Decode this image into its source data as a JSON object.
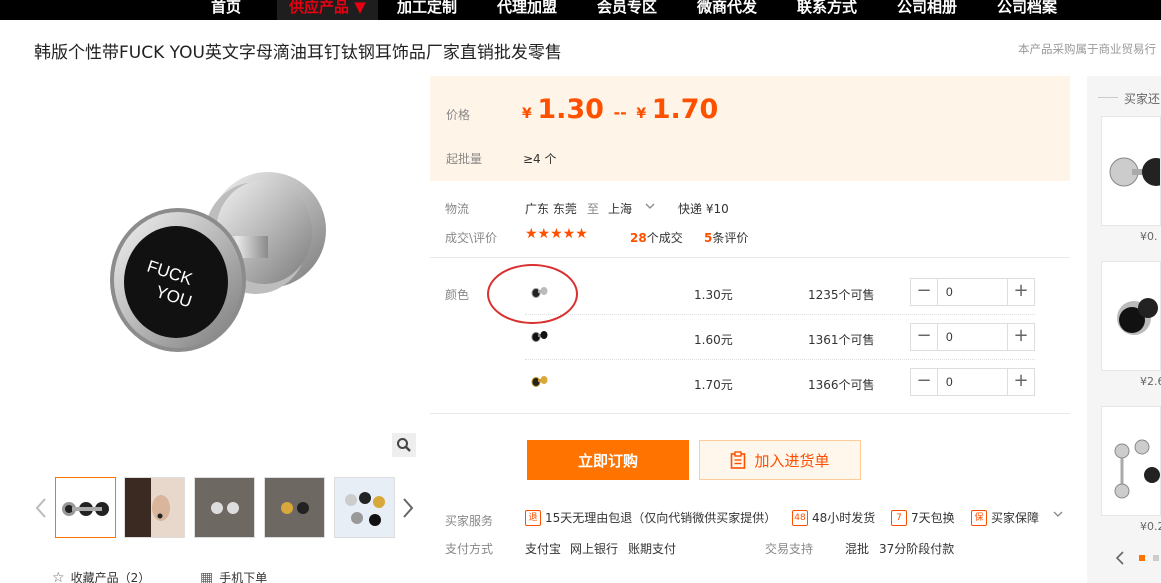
{
  "nav": {
    "items": [
      {
        "label": "首页"
      },
      {
        "label": "供应产品 ▼"
      },
      {
        "label": "加工定制"
      },
      {
        "label": "代理加盟"
      },
      {
        "label": "会员专区"
      },
      {
        "label": "微商代发"
      },
      {
        "label": "联系方式"
      },
      {
        "label": "公司相册"
      },
      {
        "label": "公司档案"
      }
    ],
    "active_color": "#e60012"
  },
  "product": {
    "title": "韩版个性带FUCK YOU英文字母滴油耳钉钛钢耳饰品厂家直销批发零售",
    "disclaimer": "本产品采购属于商业贸易行",
    "main_image_text": [
      "FUCK",
      "YOU"
    ]
  },
  "price": {
    "label": "价格",
    "currency": "¥",
    "low": "1.30",
    "separator": "--",
    "high": "1.70",
    "moq_label": "起批量",
    "moq_value": "≥4 个",
    "accent": "#ff5000"
  },
  "logistics": {
    "label": "物流",
    "from": "广东 东莞",
    "to_word": "至",
    "to": "上海",
    "shipping": "快递 ¥10"
  },
  "reviews": {
    "label": "成交\\评价",
    "stars": "★★★★★",
    "deals_count": "28",
    "deals_label": "个成交",
    "review_count": "5",
    "review_label": "条评价"
  },
  "variants": {
    "label": "颜色",
    "rows": [
      {
        "icon": "silver-earring-icon",
        "price": "1.30元",
        "stock": "1235个可售",
        "qty": "0"
      },
      {
        "icon": "black-earring-icon",
        "price": "1.60元",
        "stock": "1361个可售",
        "qty": "0"
      },
      {
        "icon": "gold-earring-icon",
        "price": "1.70元",
        "stock": "1366个可售",
        "qty": "0"
      }
    ]
  },
  "actions": {
    "buy": "立即订购",
    "cart": "加入进货单"
  },
  "services": {
    "label": "买家服务",
    "items": [
      {
        "icon": "return-icon",
        "text": "15天无理由包退（仅向代销微供买家提供）"
      },
      {
        "icon": "48h-icon",
        "text": "48小时发货"
      },
      {
        "icon": "7day-icon",
        "text": "7天包换"
      },
      {
        "icon": "shield-icon",
        "text": "买家保障"
      }
    ]
  },
  "payment": {
    "label": "支付方式",
    "methods": [
      "支付宝",
      "网上银行",
      "账期支付"
    ],
    "trade_label": "交易支持",
    "trade_items": [
      "混批",
      "37分阶段付款"
    ]
  },
  "gallery_links": {
    "favorite": "收藏产品（2）",
    "mobile": "手机下单"
  },
  "sidebar": {
    "title": "买家还",
    "prices": [
      "¥0.",
      "¥2.6",
      "¥0.2"
    ]
  }
}
